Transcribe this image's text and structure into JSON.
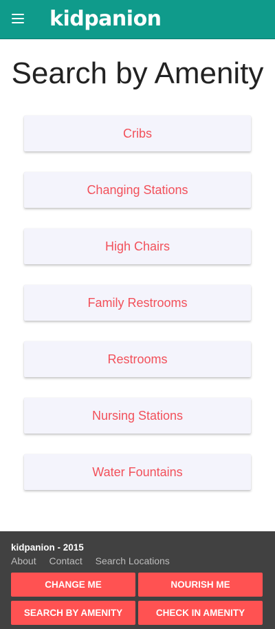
{
  "header": {
    "logo_text": "kidpanion",
    "menu_icon": "hamburger-menu-icon",
    "bg_color": "#0f9b8b"
  },
  "page": {
    "title": "Search by Amenity"
  },
  "amenities": [
    "Cribs",
    "Changing Stations",
    "High Chairs",
    "Family Restrooms",
    "Restrooms",
    "Nursing Stations",
    "Water Fountains"
  ],
  "footer": {
    "copyright": "kidpanion - 2015",
    "links": [
      "About",
      "Contact",
      "Search Locations"
    ],
    "buttons": [
      "CHANGE ME",
      "NOURISH ME",
      "SEARCH BY AMENITY",
      "CHECK IN AMENITY"
    ],
    "bg_color": "#414141",
    "button_color": "#ff5252"
  },
  "colors": {
    "accent_text": "#f2505a",
    "card_bg": "#f4f4fc"
  }
}
